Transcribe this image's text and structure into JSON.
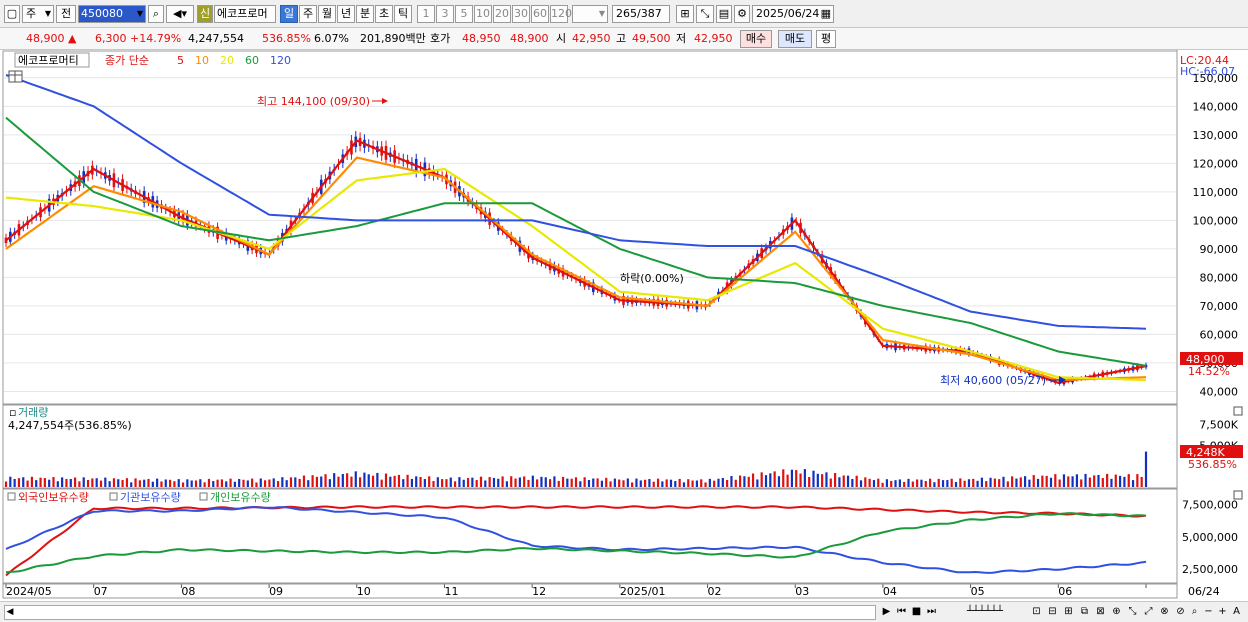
{
  "toolbar": {
    "period_select": "주",
    "prev_label": "전",
    "stock_code": "450080",
    "new_badge": "신",
    "stock_name": "에코프로머",
    "timeframes": [
      "일",
      "주",
      "월",
      "년",
      "분",
      "초",
      "틱"
    ],
    "intervals": [
      "1",
      "3",
      "5",
      "10",
      "20",
      "30",
      "60",
      "120"
    ],
    "count_display": "265",
    "count_total": "/387",
    "date": "2025/06/24"
  },
  "quote": {
    "price": "48,900",
    "change_arrow": "▲",
    "change": "6,300",
    "change_pct": "+14.79%",
    "volume": "4,247,554",
    "volume_ratio": "536.85%",
    "turnover_pct": "6.07%",
    "amount": "201,890백만",
    "hoga_label": "호가",
    "hoga1": "48,950",
    "hoga2": "48,900",
    "open_label": "시",
    "open": "42,950",
    "high_label": "고",
    "high": "49,500",
    "low_label": "저",
    "low": "42,950",
    "buy_button": "매수",
    "sell_button": "매도",
    "eval_button": "평"
  },
  "price_panel": {
    "legend_name": "에코프로머티",
    "legend_close": "종가 단순",
    "legend_ma": [
      {
        "label": "5",
        "color": "#e01010"
      },
      {
        "label": "10",
        "color": "#ff8c00"
      },
      {
        "label": "20",
        "color": "#e8e800"
      },
      {
        "label": "60",
        "color": "#1a9a3a"
      },
      {
        "label": "120",
        "color": "#3050e0"
      }
    ],
    "lc_label": "LC:20.44",
    "hc_label": "HC:-66.07",
    "current_price_label": "48,900",
    "current_pct_label": "14.52%",
    "high_annotation": "최고 144,100 (09/30)",
    "low_annotation": "최저 40,600 (05/27)",
    "mid_annotation": "하락(0.00%)"
  },
  "volume_panel": {
    "title": "거래량",
    "value_label": "4,247,554주(536.85%)",
    "current_label": "4,248K",
    "current_pct": "536.85%"
  },
  "holding_panel": {
    "legend": [
      {
        "label": "외국인보유수량",
        "color": "#e01010"
      },
      {
        "label": "기관보유수량",
        "color": "#3050e0"
      },
      {
        "label": "개인보유수량",
        "color": "#1a9a3a"
      }
    ]
  },
  "x_labels": [
    "2024/05",
    "07",
    "08",
    "09",
    "10",
    "11",
    "12",
    "2025/01",
    "02",
    "03",
    "04",
    "05",
    "06",
    "06/24"
  ],
  "colors": {
    "up": "#e01010",
    "down": "#1030c0",
    "ma5": "#e01010",
    "ma10": "#ff8c00",
    "ma20": "#e8e800",
    "ma60": "#1a9a3a",
    "ma120": "#3050e0",
    "volume_up": "#e01010",
    "volume_down": "#1030c0"
  },
  "chart_data": [
    {
      "type": "line",
      "title": "에코프로머티",
      "x": [
        "2024/05",
        "07",
        "08",
        "09",
        "10",
        "11",
        "12",
        "2025/01",
        "02",
        "03",
        "04",
        "05",
        "06",
        "06/24"
      ],
      "y_ticks": [
        40000,
        50000,
        60000,
        70000,
        80000,
        90000,
        100000,
        110000,
        120000,
        130000,
        140000,
        150000
      ],
      "ylim": [
        37000,
        158000
      ],
      "series": [
        {
          "name": "5",
          "values": [
            93000,
            118000,
            101000,
            88000,
            128000,
            115000,
            87000,
            72000,
            70000,
            100000,
            56000,
            54000,
            43000,
            48900
          ]
        },
        {
          "name": "10",
          "values": [
            90000,
            112000,
            103000,
            88000,
            122000,
            115000,
            88000,
            73000,
            70000,
            96000,
            58000,
            53000,
            44000,
            45000
          ]
        },
        {
          "name": "20",
          "values": [
            108000,
            105000,
            100000,
            90000,
            114000,
            118000,
            98000,
            75000,
            72000,
            85000,
            62000,
            54000,
            45000,
            44000
          ]
        },
        {
          "name": "60",
          "values": [
            136000,
            110000,
            98000,
            93000,
            98000,
            106000,
            106000,
            90000,
            80000,
            78000,
            70000,
            64000,
            54000,
            49000
          ]
        },
        {
          "name": "120",
          "values": [
            151000,
            140000,
            120000,
            102000,
            100000,
            100000,
            100000,
            93000,
            91000,
            91000,
            80000,
            68000,
            63000,
            62000
          ]
        }
      ],
      "annotations": [
        "최고 144,100 (09/30)",
        "최저 40,600 (05/27)",
        "하락(0.00%)"
      ]
    },
    {
      "type": "bar",
      "title": "거래량",
      "categories": [
        "2024/05",
        "07",
        "08",
        "09",
        "10",
        "11",
        "12",
        "2025/01",
        "02",
        "03",
        "04",
        "05",
        "06",
        "06/24"
      ],
      "y_ticks": [
        5000,
        7500
      ],
      "y_unit": "K",
      "values": [
        1200,
        1100,
        900,
        1000,
        1800,
        1100,
        1300,
        1000,
        900,
        2200,
        900,
        1000,
        1500,
        4248
      ]
    },
    {
      "type": "line",
      "title": "보유수량",
      "x": [
        "2024/05",
        "07",
        "08",
        "09",
        "10",
        "11",
        "12",
        "2025/01",
        "02",
        "03",
        "04",
        "05",
        "06",
        "06/24"
      ],
      "y_ticks": [
        2500000,
        5000000,
        7500000
      ],
      "series": [
        {
          "name": "외국인보유수량",
          "values": [
            2000000,
            7200000,
            7200000,
            7250000,
            7300000,
            7300000,
            7300000,
            7300000,
            7300000,
            7300000,
            7100000,
            6900000,
            6800000,
            6600000
          ]
        },
        {
          "name": "기관보유수량",
          "values": [
            4000000,
            7000000,
            7000000,
            7300000,
            6900000,
            6500000,
            4300000,
            4000000,
            4100000,
            4200000,
            3000000,
            2200000,
            2500000,
            3000000
          ]
        },
        {
          "name": "개인보유수량",
          "values": [
            2200000,
            3500000,
            4000000,
            3900000,
            3800000,
            3800000,
            4100000,
            3900000,
            3700000,
            3400000,
            5400000,
            6300000,
            6800000,
            6600000
          ]
        }
      ]
    }
  ]
}
